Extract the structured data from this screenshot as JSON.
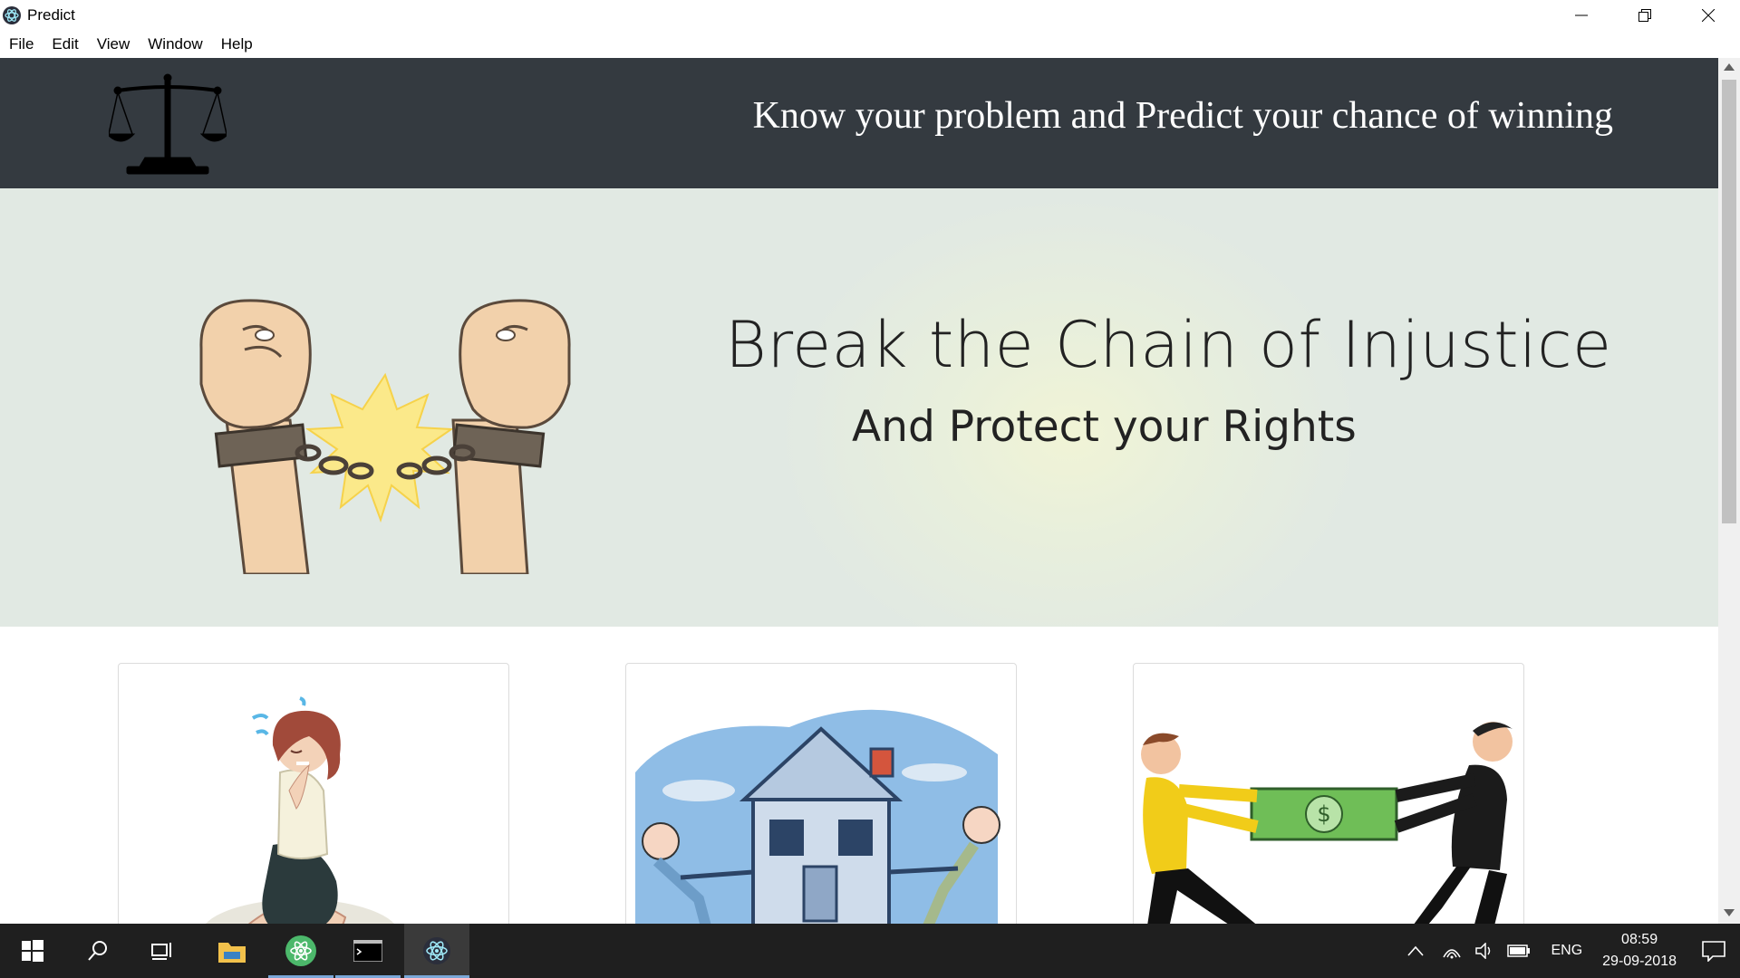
{
  "window": {
    "title": "Predict",
    "controls": [
      "minimize-icon",
      "restore-icon",
      "close-icon"
    ]
  },
  "menu": {
    "items": [
      "File",
      "Edit",
      "View",
      "Window",
      "Help"
    ]
  },
  "header": {
    "logo_icon": "scales-of-justice-icon",
    "tagline": "Know your problem and Predict your chance of winning",
    "background": "#343a40"
  },
  "hero": {
    "title": "Break the Chain of Injustice",
    "subtitle": "And Protect your Rights",
    "illustration": "fists-breaking-chain",
    "background": "#e1e9e3"
  },
  "cards": [
    {
      "illustration": "worried-woman"
    },
    {
      "illustration": "property-dispute-house"
    },
    {
      "illustration": "money-tug-of-war"
    }
  ],
  "taskbar": {
    "apps": [
      "windows-start-icon",
      "search-icon",
      "task-view-icon",
      "file-explorer-icon",
      "atom-icon",
      "terminal-icon",
      "electron-icon"
    ],
    "tray": {
      "language": "ENG",
      "time": "08:59",
      "date": "29-09-2018"
    }
  }
}
